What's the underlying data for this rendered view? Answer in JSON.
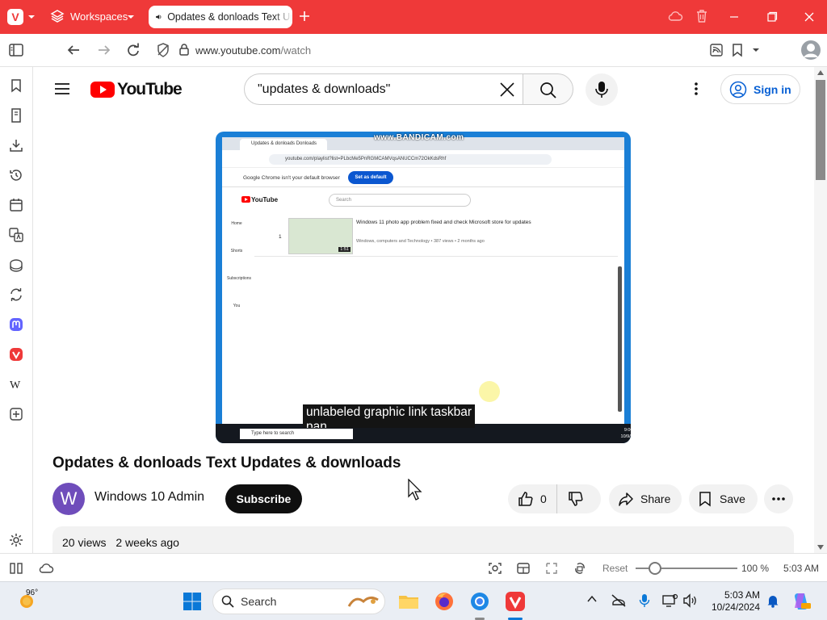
{
  "browser": {
    "workspaces_label": "Workspaces",
    "tab_title": "Opdates & donloads Text Updates & downloads",
    "url_host": "www.youtube.com",
    "url_path": "/watch"
  },
  "youtube": {
    "logo_text": "YouTube",
    "search_value": "\"updates & downloads\"",
    "signin_label": "Sign in",
    "video_title": "Opdates & donloads Text Updates & downloads",
    "channel_initial": "W",
    "channel_name": "Windows 10 Admin",
    "subscribe_label": "Subscribe",
    "like_count": "0",
    "share_label": "Share",
    "save_label": "Save",
    "views": "20 views",
    "uploaded": "2 weeks ago"
  },
  "video_frame": {
    "watermark": "www.BANDICAM.com",
    "tab_title": "Updates & donloads Donloads",
    "url": "youtube.com/playlist?list=PLbcMe5PnRGMCAMVqsANUCCm72OkKdsRhf",
    "info_message": "Google Chrome isn't your default browser",
    "info_button": "Set as default",
    "logo_text": "YouTube",
    "search_placeholder": "Search",
    "row_number": "1",
    "row_title": "Windows 11 photo app problem fixed and check Microsoft store for updates",
    "row_meta": "Windows, computers and Technology • 387 views • 2 months ago",
    "row_duration": "1:51",
    "nav_home": "Home",
    "nav_shorts": "Shorts",
    "nav_subscriptions": "Subscriptions",
    "nav_you": "You",
    "caption_line1": "unlabeled graphic link taskbar",
    "caption_line2": "pan",
    "taskbar_search": "Type here to search",
    "clock_time": "9:00 AM",
    "clock_date": "10/9/2024"
  },
  "statusbar": {
    "reset_label": "Reset",
    "zoom_percent": "100 %",
    "zoom_value": 1.0,
    "time": "5:03 AM"
  },
  "taskbar": {
    "temperature": "96°",
    "search_label": "Search",
    "clock_time": "5:03 AM",
    "clock_date": "10/24/2024"
  },
  "colors": {
    "browser_accent": "#ef3939",
    "youtube_red": "#ff0000",
    "signin_blue": "#065fd4",
    "subscribe_bg": "#0f0f0f"
  }
}
